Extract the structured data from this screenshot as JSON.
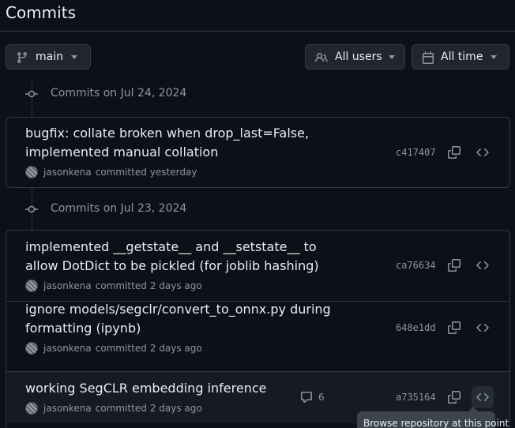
{
  "page": {
    "title": "Commits"
  },
  "filters": {
    "branch_label": "main",
    "users_label": "All users",
    "time_label": "All time"
  },
  "groups": [
    {
      "heading": "Commits on Jul 24, 2024",
      "commits": [
        {
          "message": "bugfix: collate broken when drop_last=False, implemented manual collation",
          "author": "jasonkena",
          "action": "committed",
          "when": "yesterday",
          "sha": "c417407"
        }
      ]
    },
    {
      "heading": "Commits on Jul 23, 2024",
      "commits": [
        {
          "message": "implemented __getstate__ and __setstate__ to allow DotDict to be pickled (for joblib hashing)",
          "author": "jasonkena",
          "action": "committed",
          "when": "2 days ago",
          "sha": "ca76634"
        },
        {
          "message": "ignore models/segclr/convert_to_onnx.py during formatting (ipynb)",
          "author": "jasonkena",
          "action": "committed",
          "when": "2 days ago",
          "sha": "648e1dd"
        },
        {
          "message": "working SegCLR embedding inference",
          "author": "jasonkena",
          "action": "committed",
          "when": "2 days ago",
          "sha": "a735164",
          "comment_count": "6"
        }
      ]
    }
  ],
  "tooltip": {
    "text": "Browse repository at this point"
  },
  "icons": {
    "branch": "git-branch-icon",
    "users": "people-icon",
    "calendar": "calendar-icon",
    "commit": "git-commit-icon",
    "copy": "copy-icon",
    "code": "code-icon",
    "comment": "comment-icon",
    "caret": "triangle-down-icon"
  },
  "colors": {
    "background": "#0d1117",
    "border": "#30363d",
    "text": "#e6edf3",
    "muted": "#8d96a0",
    "button_bg": "#21262d",
    "tooltip_bg": "#3d444d"
  }
}
